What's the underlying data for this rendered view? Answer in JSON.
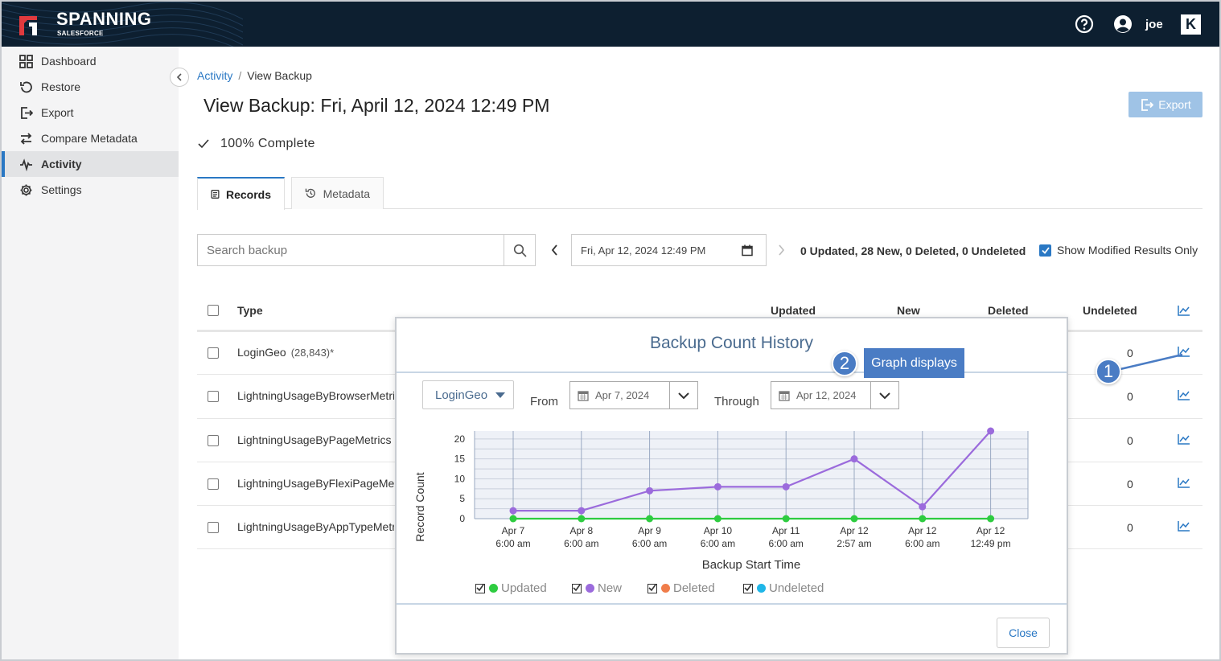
{
  "header": {
    "brand": "SPANNING",
    "brand_sub": "SALESFORCE",
    "user_name": "joe",
    "k_badge": "K"
  },
  "sidebar": {
    "items": [
      {
        "label": "Dashboard",
        "icon": "grid-icon"
      },
      {
        "label": "Restore",
        "icon": "restore-icon"
      },
      {
        "label": "Export",
        "icon": "export-icon"
      },
      {
        "label": "Compare Metadata",
        "icon": "compare-icon"
      },
      {
        "label": "Activity",
        "icon": "activity-icon",
        "active": true
      },
      {
        "label": "Settings",
        "icon": "gear-icon"
      }
    ]
  },
  "breadcrumb": {
    "parent": "Activity",
    "separator": "/",
    "current": "View Backup"
  },
  "page_title": "View Backup: Fri, April 12, 2024 12:49 PM",
  "export_label": "Export",
  "status": "100% Complete",
  "tabs": [
    {
      "label": "Records",
      "active": true
    },
    {
      "label": "Metadata",
      "active": false
    }
  ],
  "search": {
    "placeholder": "Search backup"
  },
  "backup_date": "Fri, Apr 12, 2024 12:49 PM",
  "summary": "0 Updated, 28 New, 0 Deleted, 0 Undeleted",
  "show_modified_label": "Show Modified Results Only",
  "table": {
    "columns": {
      "type": "Type",
      "updated": "Updated",
      "new": "New",
      "deleted": "Deleted",
      "undeleted": "Undeleted"
    },
    "rows": [
      {
        "type": "LoginGeo",
        "count": "(28,843)*",
        "undeleted": "0"
      },
      {
        "type": "LightningUsageByBrowserMetrics",
        "count": "",
        "undeleted": "0"
      },
      {
        "type": "LightningUsageByPageMetrics",
        "count": "",
        "undeleted": "0"
      },
      {
        "type": "LightningUsageByFlexiPageMetrics",
        "count": "",
        "undeleted": "0"
      },
      {
        "type": "LightningUsageByAppTypeMetrics",
        "count": "",
        "undeleted": "0"
      }
    ]
  },
  "modal": {
    "title": "Backup Count History",
    "type_select": "LoginGeo",
    "from_label": "From",
    "from_date": "Apr 7, 2024",
    "through_label": "Through",
    "through_date": "Apr 12, 2024",
    "close_label": "Close",
    "legend": [
      {
        "label": "Updated",
        "color": "#2ecc40"
      },
      {
        "label": "New",
        "color": "#9b6bdc"
      },
      {
        "label": "Deleted",
        "color": "#f07d4a"
      },
      {
        "label": "Undeleted",
        "color": "#1fb6e8"
      }
    ]
  },
  "chart_data": {
    "type": "line",
    "categories": [
      [
        "Apr 7",
        "6:00 am"
      ],
      [
        "Apr 8",
        "6:00 am"
      ],
      [
        "Apr 9",
        "6:00 am"
      ],
      [
        "Apr 10",
        "6:00 am"
      ],
      [
        "Apr 11",
        "6:00 am"
      ],
      [
        "Apr 12",
        "2:57 am"
      ],
      [
        "Apr 12",
        "6:00 am"
      ],
      [
        "Apr 12",
        "12:49 pm"
      ]
    ],
    "series": [
      {
        "name": "Updated",
        "color": "#2ecc40",
        "values": [
          0,
          0,
          0,
          0,
          0,
          0,
          0,
          0
        ]
      },
      {
        "name": "New",
        "color": "#9b6bdc",
        "values": [
          2,
          2,
          7,
          8,
          8,
          15,
          3,
          22
        ]
      }
    ],
    "xlabel": "Backup Start Time",
    "ylabel": "Record Count",
    "yticks": [
      0,
      5,
      10,
      15,
      20
    ],
    "ylim": [
      0,
      22
    ],
    "grid": true
  },
  "callouts": {
    "badge1": "1",
    "badge2": "2",
    "callout_text": "Graph displays"
  },
  "colors": {
    "accent": "#2a78c4",
    "header_bg": "#0d1f30",
    "callout": "#4a7cc4"
  }
}
